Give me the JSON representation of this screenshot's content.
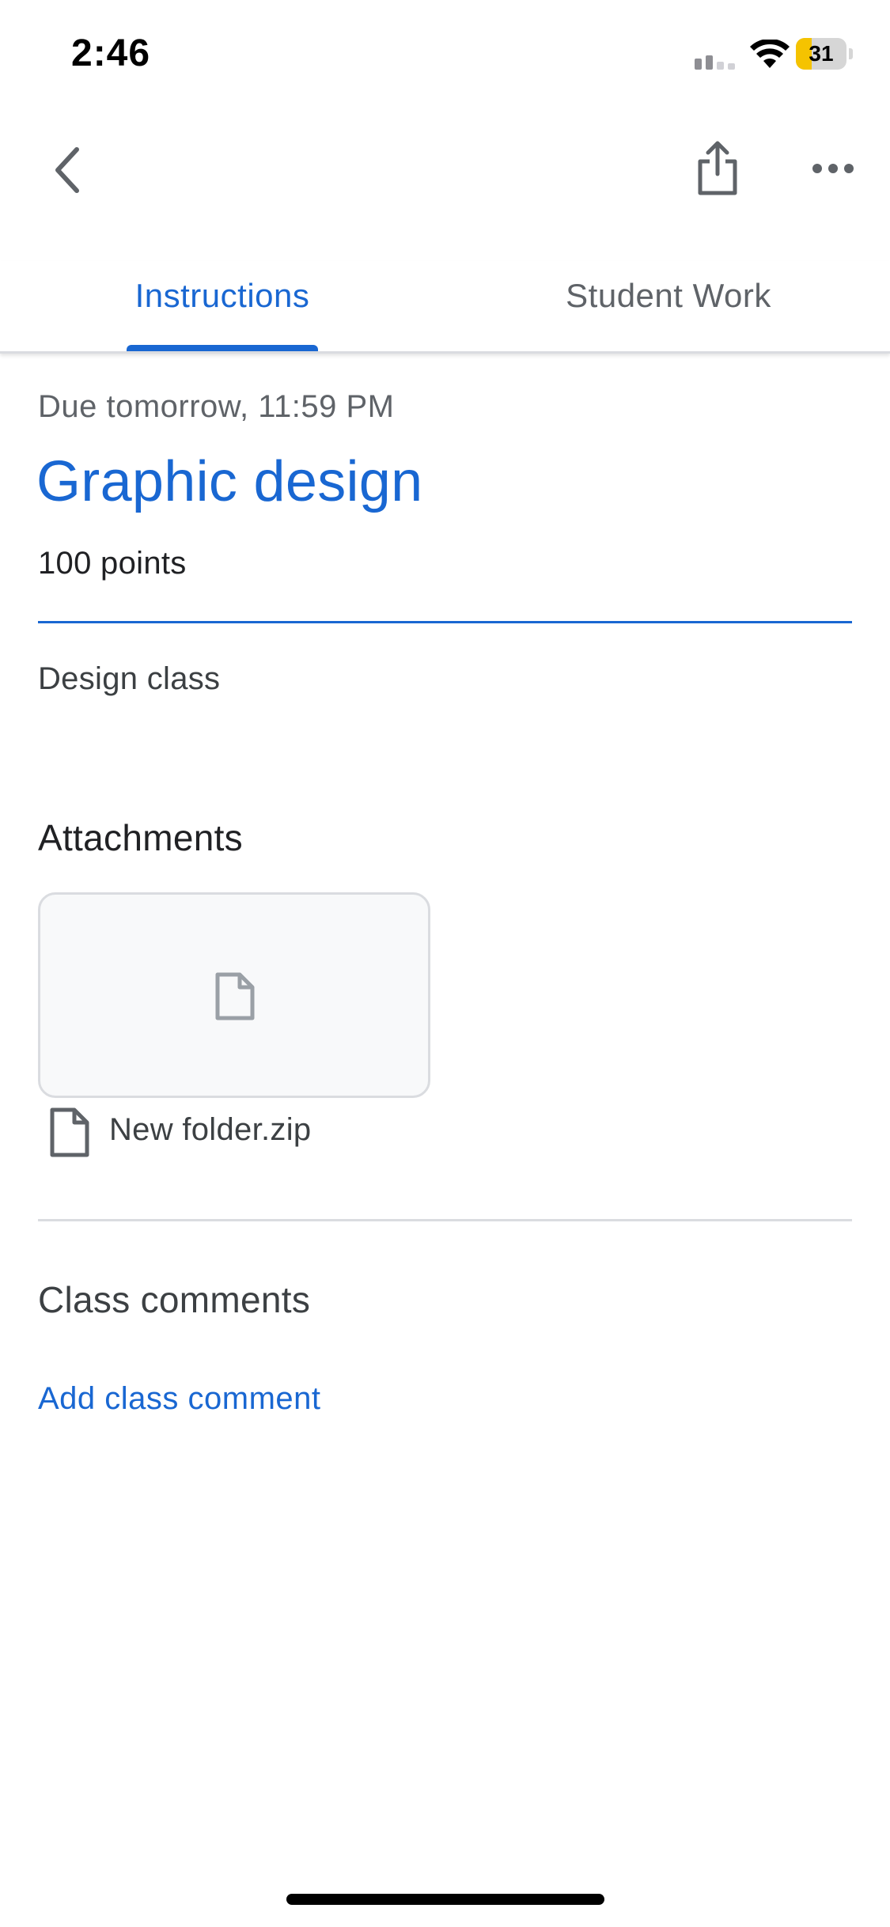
{
  "status_bar": {
    "time": "2:46",
    "battery_level": "31",
    "battery_fill_percent": 31,
    "icons": [
      "signal-icon",
      "wifi-icon",
      "battery-charging-icon"
    ]
  },
  "app_bar": {
    "icons": [
      "back-icon",
      "share-icon",
      "more-options-icon"
    ]
  },
  "tabs": [
    {
      "label": "Instructions",
      "selected": true
    },
    {
      "label": "Student Work",
      "selected": false
    }
  ],
  "assignment": {
    "due": "Due tomorrow, 11:59 PM",
    "title": "Graphic design",
    "points": "100 points",
    "description": "Design class"
  },
  "attachments": {
    "heading": "Attachments",
    "items": [
      {
        "name": "New folder.zip",
        "icon": "file-icon"
      }
    ]
  },
  "comments": {
    "heading": "Class comments",
    "add_label": "Add class comment"
  },
  "colors": {
    "accent": "#1967d2",
    "text_primary": "#202124",
    "text_secondary": "#5f6368",
    "divider": "#dadce0",
    "card_background": "#f8f9fa",
    "battery_fill": "#f5c300"
  }
}
